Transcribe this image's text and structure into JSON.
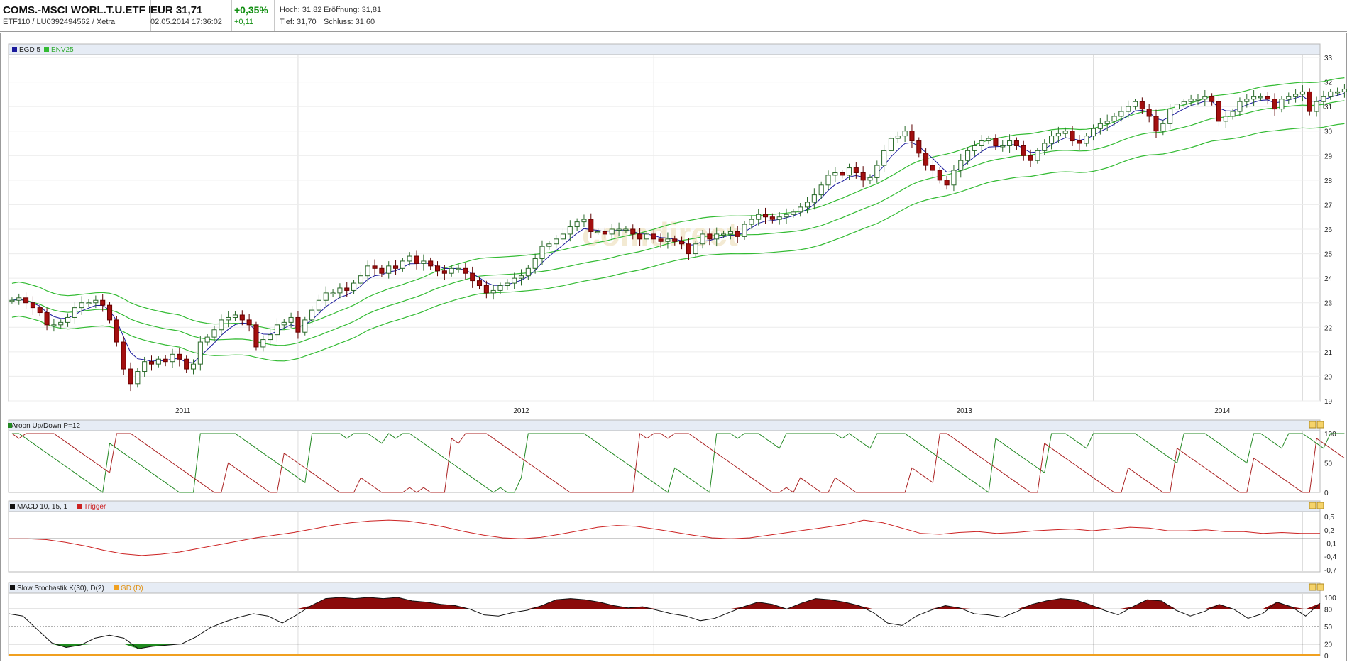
{
  "header": {
    "instrument_name": "COMS.-MSCI WORL.T.U.ETF I",
    "instrument_ids": "ETF110 / LU0392494562 / Xetra",
    "price": "EUR 31,71",
    "datetime": "02.05.2014 17:36:02",
    "change_pct": "+0,35%",
    "change_abs": "+0,11",
    "high": "Hoch: 31,82",
    "open": "Eröffnung: 31,81",
    "low": "Tief: 31,70",
    "close": "Schluss: 31,60"
  },
  "colors": {
    "up_candle": "#ffffff",
    "down_candle": "#a30f0f",
    "ema_line": "#1a1a9c",
    "envelope": "#33bb33",
    "aroon_up": "#228822",
    "aroon_down": "#aa2222",
    "macd_trigger": "#cc2222",
    "stoch_overbought": "#8b0a0a",
    "stoch_oversold": "#1f8a1f",
    "panel_header": "#e6ecf5"
  },
  "watermark": "comdirect",
  "chart_data": [
    {
      "type": "candlestick",
      "legend": [
        "EGD 5",
        "ENV25"
      ],
      "x_tick_labels": [
        "2011",
        "2012",
        "2013",
        "2014"
      ],
      "y_ticks": [
        19,
        20,
        21,
        22,
        23,
        24,
        25,
        26,
        27,
        28,
        29,
        30,
        31,
        32,
        33
      ],
      "ylim": [
        19,
        33
      ],
      "x_range_weeks": [
        0,
        188
      ],
      "year_starts_week": [
        41.5,
        92.5,
        155.5,
        185.5
      ],
      "close_series": [
        23.1,
        23.2,
        23.0,
        22.8,
        22.6,
        22.1,
        22.1,
        22.2,
        22.4,
        22.8,
        23.0,
        23.0,
        23.1,
        22.9,
        22.3,
        21.4,
        20.3,
        19.7,
        20.2,
        20.6,
        20.5,
        20.7,
        20.6,
        20.9,
        20.7,
        20.3,
        20.5,
        21.4,
        21.6,
        21.9,
        22.3,
        22.4,
        22.5,
        22.3,
        22.1,
        21.2,
        21.5,
        21.7,
        22.1,
        22.2,
        22.4,
        21.8,
        22.3,
        22.7,
        23.1,
        23.4,
        23.4,
        23.6,
        23.5,
        23.8,
        24.1,
        24.5,
        24.4,
        24.2,
        24.5,
        24.4,
        24.7,
        24.9,
        24.6,
        24.7,
        24.5,
        24.3,
        24.2,
        24.4,
        24.4,
        24.2,
        23.9,
        23.7,
        23.4,
        23.5,
        23.7,
        23.8,
        24.0,
        24.1,
        24.4,
        24.8,
        25.3,
        25.4,
        25.6,
        25.8,
        26.1,
        26.3,
        26.4,
        25.9,
        25.9,
        25.8,
        26.0,
        26.0,
        26.0,
        25.8,
        25.6,
        25.8,
        25.6,
        25.5,
        25.6,
        25.5,
        25.4,
        25.0,
        25.4,
        25.8,
        25.6,
        25.8,
        25.8,
        25.9,
        25.7,
        26.2,
        26.4,
        26.6,
        26.5,
        26.4,
        26.5,
        26.6,
        26.7,
        26.9,
        27.1,
        27.4,
        27.8,
        28.2,
        28.3,
        28.2,
        28.5,
        28.3,
        28.0,
        28.1,
        28.6,
        29.2,
        29.7,
        29.8,
        30.0,
        29.6,
        29.1,
        28.6,
        28.4,
        28.0,
        27.8,
        28.4,
        28.8,
        29.2,
        29.4,
        29.6,
        29.7,
        29.4,
        29.4,
        29.6,
        29.4,
        29.0,
        28.8,
        29.2,
        29.5,
        29.8,
        29.9,
        30.0,
        29.6,
        29.5,
        29.8,
        30.1,
        30.3,
        30.4,
        30.6,
        30.8,
        31.0,
        31.2,
        30.9,
        30.6,
        30.0,
        30.3,
        30.9,
        31.1,
        31.2,
        31.3,
        31.3,
        31.4,
        31.2,
        30.4,
        30.6,
        30.8,
        31.2,
        31.3,
        31.4,
        31.4,
        31.3,
        30.9,
        31.3,
        31.4,
        31.5,
        31.6,
        30.8,
        31.2,
        31.4,
        31.6,
        31.6,
        31.71
      ]
    },
    {
      "type": "line",
      "title": "Aroon Up/Down P=12",
      "series_names": [
        "Aroon Up",
        "Aroon Down"
      ],
      "y_ticks": [
        0,
        50,
        100
      ],
      "ylim": [
        0,
        100
      ],
      "dotted_level": 50
    },
    {
      "type": "line",
      "title": "MACD 10, 15, 1",
      "legend": [
        "MACD 10, 15, 1",
        "Trigger"
      ],
      "y_ticks": [
        "0,5",
        "0,2",
        "-0,1",
        "-0,4",
        "-0,7"
      ],
      "y_tick_values": [
        0.5,
        0.2,
        -0.1,
        -0.4,
        -0.7
      ],
      "ylim": [
        -0.75,
        0.55
      ],
      "zero_line": 0,
      "values": [
        0.0,
        0.0,
        -0.02,
        -0.08,
        -0.16,
        -0.26,
        -0.34,
        -0.38,
        -0.35,
        -0.3,
        -0.22,
        -0.14,
        -0.06,
        0.02,
        0.08,
        0.14,
        0.22,
        0.3,
        0.36,
        0.4,
        0.42,
        0.4,
        0.34,
        0.26,
        0.16,
        0.08,
        0.02,
        0.0,
        0.03,
        0.1,
        0.18,
        0.26,
        0.3,
        0.28,
        0.22,
        0.15,
        0.08,
        0.02,
        0.0,
        0.02,
        0.08,
        0.14,
        0.2,
        0.26,
        0.32,
        0.42,
        0.36,
        0.24,
        0.12,
        0.1,
        0.14,
        0.16,
        0.12,
        0.14,
        0.18,
        0.2,
        0.22,
        0.18,
        0.22,
        0.26,
        0.24,
        0.18,
        0.18,
        0.2,
        0.16,
        0.16,
        0.12,
        0.14,
        0.12,
        0.12
      ]
    },
    {
      "type": "area",
      "title": "Slow Stochastik K(30), D(2)",
      "legend": [
        "Slow Stochastik K(30), D(2)",
        "GD (D)"
      ],
      "y_ticks": [
        0,
        20,
        50,
        80,
        100
      ],
      "ylim": [
        0,
        100
      ],
      "levels": [
        20,
        50,
        80
      ],
      "values": [
        72,
        68,
        45,
        22,
        14,
        18,
        30,
        35,
        30,
        12,
        16,
        18,
        20,
        32,
        48,
        58,
        66,
        72,
        68,
        56,
        70,
        86,
        98,
        100,
        98,
        100,
        98,
        100,
        94,
        92,
        88,
        86,
        80,
        70,
        68,
        74,
        78,
        86,
        96,
        98,
        96,
        92,
        86,
        82,
        84,
        78,
        72,
        68,
        60,
        64,
        74,
        84,
        92,
        88,
        80,
        90,
        98,
        96,
        92,
        86,
        74,
        56,
        52,
        68,
        78,
        86,
        82,
        72,
        70,
        66,
        76,
        88,
        94,
        98,
        96,
        88,
        78,
        70,
        84,
        96,
        94,
        78,
        68,
        76,
        88,
        80,
        64,
        72,
        92,
        84,
        68,
        90
      ]
    }
  ]
}
